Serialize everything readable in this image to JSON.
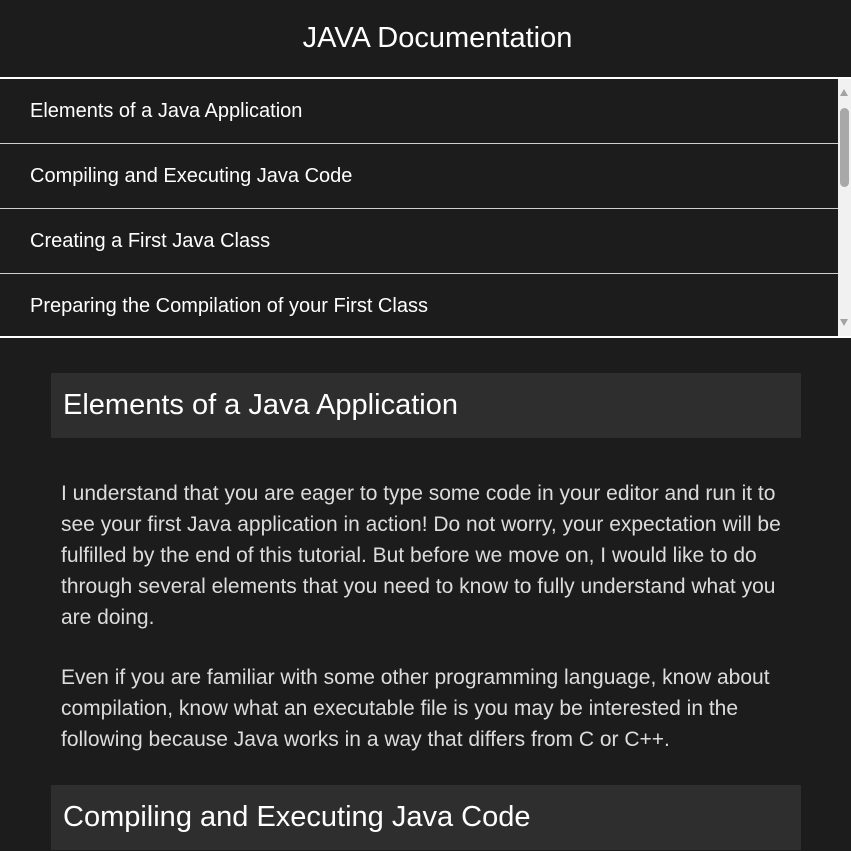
{
  "header": {
    "title": "JAVA Documentation"
  },
  "nav": {
    "items": [
      {
        "label": "Elements of a Java Application"
      },
      {
        "label": "Compiling and Executing Java Code"
      },
      {
        "label": "Creating a First Java Class"
      },
      {
        "label": "Preparing the Compilation of your First Class"
      }
    ]
  },
  "main": {
    "sections": [
      {
        "title": "Elements of a Java Application",
        "paragraphs": [
          "I understand that you are eager to type some code in your editor and run it to see your first Java application in action! Do not worry, your expectation will be fulfilled by the end of this tutorial. But before we move on, I would like to do through several elements that you need to know to fully understand what you are doing.",
          "Even if you are familiar with some other programming language, know about compilation, know what an executable file is you may be interested in the following because Java works in a way that differs from C or C++."
        ]
      },
      {
        "title": "Compiling and Executing Java Code"
      }
    ]
  },
  "colors": {
    "background": "#1c1c1c",
    "section_header_bg": "#2e2e2e",
    "text": "#ffffff",
    "body_text": "#dcdcdc"
  }
}
